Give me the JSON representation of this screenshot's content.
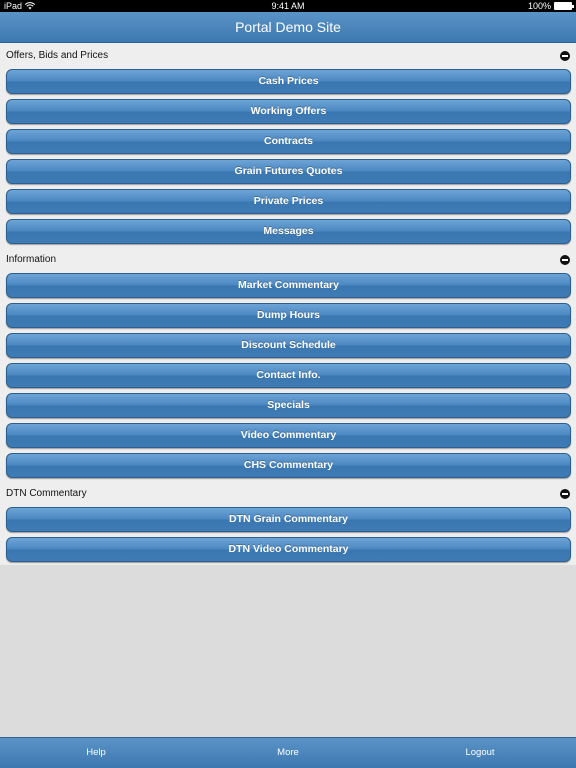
{
  "status": {
    "device": "iPad",
    "time": "9:41 AM",
    "battery": "100%"
  },
  "header": {
    "title": "Portal Demo Site"
  },
  "sections": [
    {
      "title": "Offers, Bids and Prices",
      "items": [
        "Cash Prices",
        "Working Offers",
        "Contracts",
        "Grain Futures Quotes",
        "Private Prices",
        "Messages"
      ]
    },
    {
      "title": "Information",
      "items": [
        "Market Commentary",
        "Dump Hours",
        "Discount Schedule",
        "Contact Info.",
        "Specials",
        "Video Commentary",
        "CHS Commentary"
      ]
    },
    {
      "title": "DTN Commentary",
      "items": [
        "DTN Grain Commentary",
        "DTN Video Commentary"
      ]
    }
  ],
  "tabbar": {
    "help": "Help",
    "more": "More",
    "logout": "Logout"
  },
  "colors": {
    "accent": "#4a86c0",
    "background": "#dcdcdc"
  }
}
